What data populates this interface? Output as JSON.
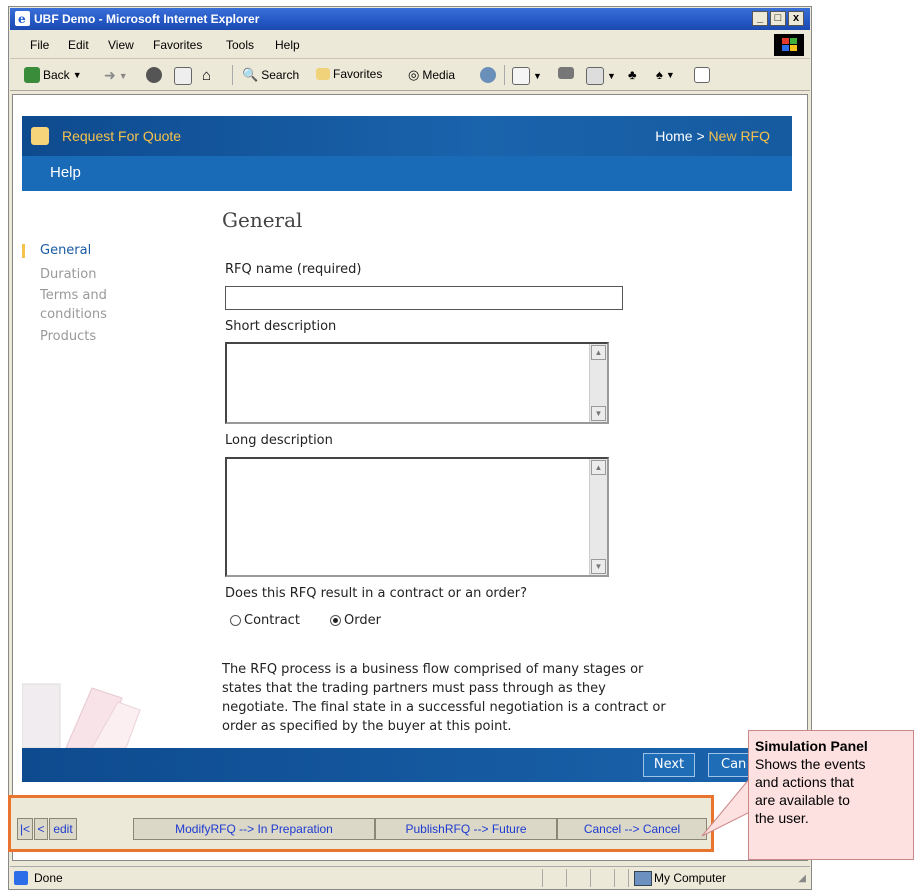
{
  "window": {
    "title": "UBF Demo - Microsoft Internet Explorer",
    "controls": [
      "_",
      "□",
      "x"
    ]
  },
  "menu": [
    "File",
    "Edit",
    "View",
    "Favorites",
    "Tools",
    "Help"
  ],
  "toolbar": {
    "back": "Back",
    "search": "Search",
    "favorites": "Favorites",
    "media": "Media"
  },
  "header": {
    "title": "Request For Quote",
    "breadcrumb_home": "Home",
    "breadcrumb_sep": " > ",
    "breadcrumb_current": "New RFQ",
    "help": "Help"
  },
  "nav": [
    "General",
    "Duration",
    "Terms and",
    "conditions",
    "Products"
  ],
  "form": {
    "heading": "General",
    "rfq_name_label": "RFQ name (required)",
    "rfq_name_value": "",
    "short_desc_label": "Short description",
    "long_desc_label": "Long description",
    "question": "Does this RFQ result in a contract or an order?",
    "option_contract": "Contract",
    "option_order": "Order",
    "selected": "Order"
  },
  "paragraph": [
    "The RFQ process is a business flow comprised of many stages or",
    "states that the trading partners must pass through as they",
    "negotiate. The final state in a successful negotiation is a contract or",
    "order as specified by the buyer at this point."
  ],
  "footer": {
    "next": "Next",
    "cancel_partial": "Can"
  },
  "simulation": {
    "first": "|<",
    "prev": "<",
    "edit": "edit",
    "actions": [
      "ModifyRFQ --> In Preparation",
      "PublishRFQ --> Future",
      "Cancel --> Cancel"
    ]
  },
  "status": {
    "left": "Done",
    "zone": "My Computer"
  },
  "callout": {
    "title": "Simulation Panel",
    "lines": [
      "Shows the events",
      "and actions that",
      "are available to",
      "the user."
    ]
  },
  "colors": {
    "accent_gold": "#f5c24c",
    "header_blue": "#1a64ad",
    "highlight_orange": "#e8742e",
    "callout_pink": "#fde0e0"
  }
}
